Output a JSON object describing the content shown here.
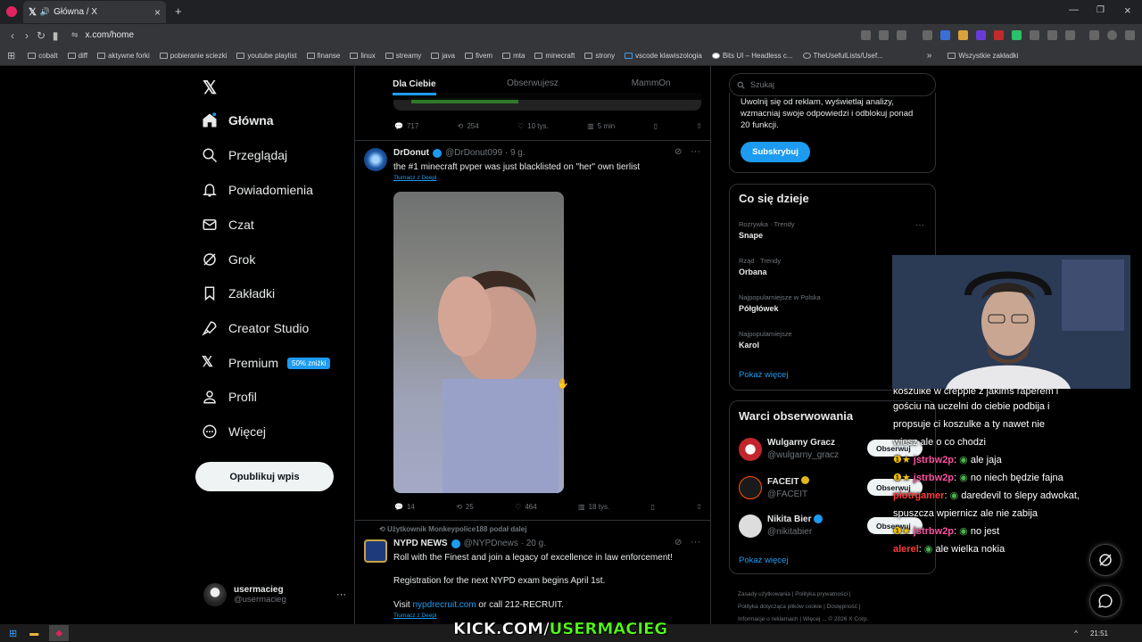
{
  "browser": {
    "tab_title": "Główna / X",
    "url": "x.com/home",
    "bookmarks": [
      "cobalt",
      "diff",
      "aktywne forki",
      "pobieranie sciezki",
      "youtube playlist",
      "finanse",
      "linux",
      "streamy",
      "java",
      "fivem",
      "mta",
      "minecraft",
      "strony",
      "vscode klawiszologia",
      "Bits UI – Headless c...",
      "TheUsefulLists/Usef..."
    ],
    "all_bookmarks": "Wszystkie zakładki"
  },
  "nav": {
    "items": [
      "Główna",
      "Przeglądaj",
      "Powiadomienia",
      "Czat",
      "Grok",
      "Zakładki",
      "Creator Studio",
      "Premium",
      "Profil",
      "Więcej"
    ],
    "premium_badge": "50% zniżki",
    "publish": "Opublikuj wpis",
    "user_name": "usermacieg",
    "user_handle": "@usermacieg"
  },
  "feed": {
    "tabs": [
      "Dla Ciebie",
      "Obserwujesz",
      "MammOn"
    ],
    "top_actions": {
      "replies": "717",
      "reposts": "254",
      "likes": "10 tys.",
      "views": "5 min"
    },
    "tweet1": {
      "name": "DrDonut",
      "handle": "@DrDonut099 · 9 g.",
      "text": "the #1 minecraft pvper was just blacklisted on \"her\" own tierlist",
      "translate": "Tłumacz z Deepl",
      "replies": "14",
      "reposts": "25",
      "likes": "464",
      "views": "18 tys."
    },
    "tweet2": {
      "repost_by": "Użytkownik Monkeypolice188 podał dalej",
      "name": "NYPD NEWS",
      "handle": "@NYPDnews · 20 g.",
      "line1": "Roll with the Finest and join a legacy of excellence in law enforcement!",
      "line2": "Registration for the next NYPD exam begins April 1st.",
      "line3_pre": "Visit ",
      "line3_link": "nypdrecruit.com",
      "line3_post": " or call 212-RECRUIT.",
      "translate": "Tłumacz z Deepl"
    }
  },
  "right": {
    "search_placeholder": "Szukaj",
    "premium_text": "Uwolnij się od reklam, wyświetlaj analizy, wzmacniaj swoje odpowiedzi i odblokuj ponad 20 funkcji.",
    "subscribe": "Subskrybuj",
    "trends_title": "Co się dzieje",
    "trends": [
      {
        "meta": "Rozrywka · Trendy",
        "name": "Snape"
      },
      {
        "meta": "Rząd · Trendy",
        "name": "Orbana"
      },
      {
        "meta": "Najpopularniejsze w Polska",
        "name": "Półgłówek"
      },
      {
        "meta": "Najpopularniejsze",
        "name": "Karol"
      }
    ],
    "show_more": "Pokaż więcej",
    "follow_title": "Warci obserwowania",
    "follow": [
      {
        "name": "Wulgarny Gracz",
        "handle": "@wulgarny_gracz"
      },
      {
        "name": "FACEIT",
        "handle": "@FACEIT"
      },
      {
        "name": "Nikita Bier",
        "handle": "@nikitabier"
      }
    ],
    "follow_btn": "Obserwuj",
    "footer": [
      "Zasady użytkowania",
      "Polityka prywatności",
      "Polityka dotycząca plików cookie",
      "Dostępność",
      "Informacje o reklamach",
      "Więcej ...",
      "© 2026 X Corp."
    ]
  },
  "chat": {
    "lines": [
      {
        "user": "",
        "text": "koszulke w creppie z jakims raperem i"
      },
      {
        "user": "",
        "text": "gościu na uczelni do ciebie podbija i"
      },
      {
        "user": "",
        "text": "propsuje ci koszulke a ty nawet nie"
      },
      {
        "user": "",
        "text": "wiesz ale o co chodzi"
      },
      {
        "user": "jstrbw2p",
        "text": "ale jaja"
      },
      {
        "user": "jstrbw2p",
        "text": "no niech będzie fajna"
      },
      {
        "user": "piotrgamer",
        "text": "daredevil to ślepy adwokat,"
      },
      {
        "user": "",
        "text": "spuszcza wpiernicz ale nie zabija"
      },
      {
        "user": "jstrbw2p",
        "text": "no jest"
      },
      {
        "user": "alerel",
        "text": "ale wielka nokia"
      }
    ]
  },
  "overlay": {
    "kick_white": "KICK.COM/",
    "kick_green": "USERMACIEG"
  },
  "taskbar": {
    "time": "21:51"
  },
  "colors": {
    "accent": "#1d9bf0",
    "kick_green": "#53fc18",
    "chat_pink": "#ff4fa3",
    "chat_red": "#ff3b3b"
  }
}
